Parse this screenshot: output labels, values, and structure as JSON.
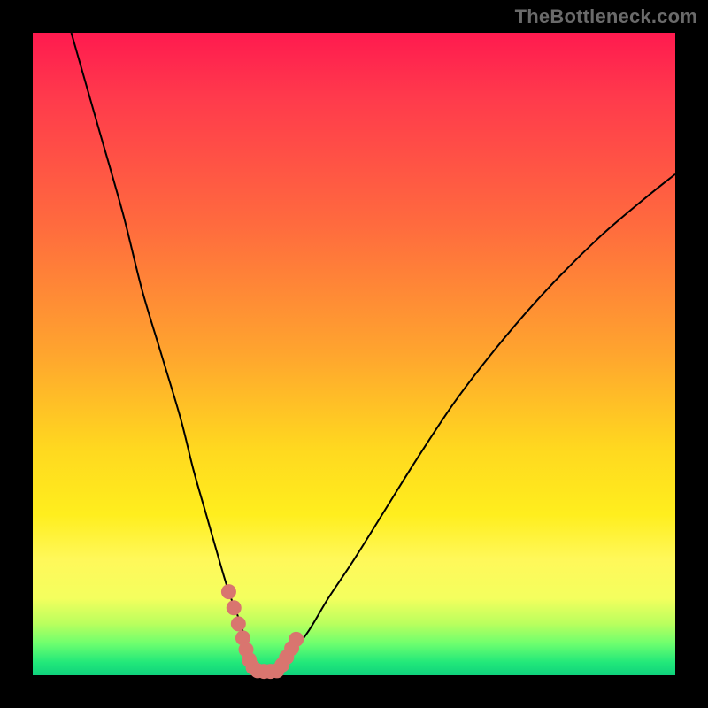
{
  "watermark": "TheBottleneck.com",
  "colors": {
    "gradient_top": "#ff1a4f",
    "gradient_mid": "#ffd91f",
    "gradient_bottom": "#0fd27c",
    "curve": "#000000",
    "marker": "#d9756f",
    "frame": "#000000"
  },
  "chart_data": {
    "type": "line",
    "title": "",
    "xlabel": "",
    "ylabel": "",
    "xlim": [
      0,
      100
    ],
    "ylim": [
      0,
      100
    ],
    "grid": false,
    "legend": false,
    "note": "Axes are unlabeled in the source image. x/y are normalized percentages of the plot area: x left→right, y bottom→top.",
    "series": [
      {
        "name": "left-curve",
        "x": [
          6,
          10,
          14,
          17,
          20,
          23,
          25,
          27,
          29,
          30.5,
          32,
          33,
          34,
          34.5,
          35
        ],
        "y": [
          100,
          86,
          72,
          60,
          50,
          40,
          32,
          25,
          18,
          13,
          9,
          6,
          3.5,
          2,
          0.5
        ]
      },
      {
        "name": "right-curve",
        "x": [
          38,
          40,
          43,
          46,
          50,
          55,
          60,
          66,
          73,
          80,
          88,
          95,
          100
        ],
        "y": [
          0.5,
          3,
          7,
          12,
          18,
          26,
          34,
          43,
          52,
          60,
          68,
          74,
          78
        ]
      }
    ],
    "markers": {
      "name": "highlighted-points",
      "color": "#d9756f",
      "points": [
        {
          "x": 30.5,
          "y": 13
        },
        {
          "x": 31.3,
          "y": 10.5
        },
        {
          "x": 32.0,
          "y": 8
        },
        {
          "x": 32.7,
          "y": 5.8
        },
        {
          "x": 33.2,
          "y": 4
        },
        {
          "x": 33.7,
          "y": 2.4
        },
        {
          "x": 34.3,
          "y": 1.2
        },
        {
          "x": 35.0,
          "y": 0.7
        },
        {
          "x": 36.0,
          "y": 0.6
        },
        {
          "x": 37.0,
          "y": 0.6
        },
        {
          "x": 38.0,
          "y": 0.7
        },
        {
          "x": 38.8,
          "y": 1.6
        },
        {
          "x": 39.5,
          "y": 2.8
        },
        {
          "x": 40.3,
          "y": 4.2
        },
        {
          "x": 41.0,
          "y": 5.6
        }
      ]
    }
  }
}
